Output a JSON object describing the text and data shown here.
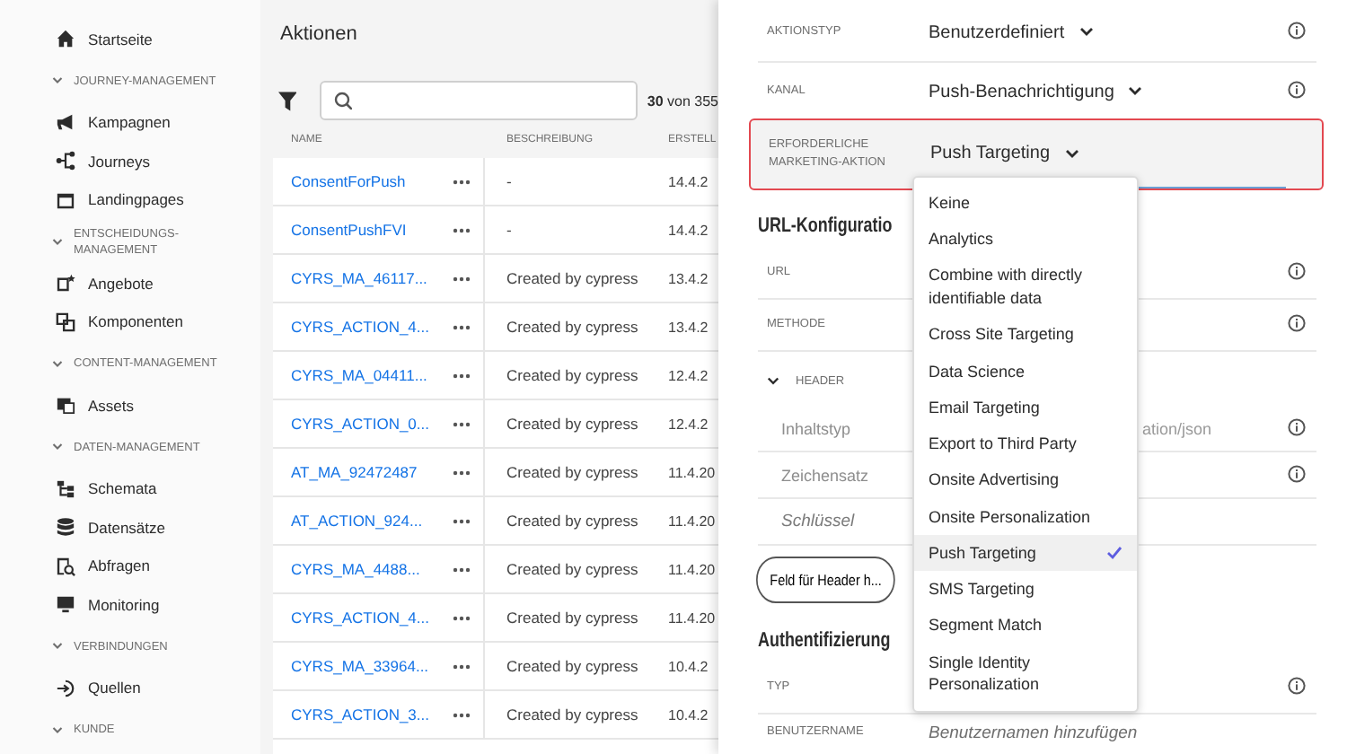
{
  "sidebar": {
    "home": {
      "label": "Startseite"
    },
    "sections": [
      {
        "title": "JOURNEY-MANAGEMENT",
        "expanded": true,
        "items": [
          {
            "label": "Kampagnen"
          },
          {
            "label": "Journeys"
          },
          {
            "label": "Landingpages"
          }
        ]
      },
      {
        "title": "ENTSCHEIDUNGS-MANAGEMENT",
        "expanded": true,
        "items": [
          {
            "label": "Angebote"
          },
          {
            "label": "Komponenten"
          }
        ]
      },
      {
        "title": "CONTENT-MANAGEMENT",
        "expanded": true,
        "items": [
          {
            "label": "Assets"
          }
        ]
      },
      {
        "title": "DATEN-MANAGEMENT",
        "expanded": true,
        "items": [
          {
            "label": "Schemata"
          },
          {
            "label": "Datensätze"
          },
          {
            "label": "Abfragen"
          },
          {
            "label": "Monitoring"
          }
        ]
      },
      {
        "title": "VERBINDUNGEN",
        "expanded": true,
        "items": [
          {
            "label": "Quellen"
          }
        ]
      },
      {
        "title": "KUNDE",
        "expanded": true
      }
    ]
  },
  "list": {
    "title": "Aktionen",
    "count": "**30** von 355",
    "columns": [
      "NAME",
      "BESCHREIBUNG",
      "ERSTELL"
    ],
    "rows": [
      {
        "name": "ConsentForPush",
        "description": "-",
        "created": "14.4.2"
      },
      {
        "name": "ConsentPushFVI",
        "description": "-",
        "created": "14.4.2"
      },
      {
        "name": "CYRS_MA_46117...",
        "description": "Created by cypress",
        "created": "13.4.2"
      },
      {
        "name": "CYRS_ACTION_4...",
        "description": "Created by cypress",
        "created": "13.4.2"
      },
      {
        "name": "CYRS_MA_04411...",
        "description": "Created by cypress",
        "created": "12.4.2"
      },
      {
        "name": "CYRS_ACTION_0...",
        "description": "Created by cypress",
        "created": "12.4.2"
      },
      {
        "name": "AT_MA_92472487",
        "description": "Created by cypress",
        "created": "11.4.20"
      },
      {
        "name": "AT_ACTION_924...",
        "description": "Created by cypress",
        "created": "11.4.20"
      },
      {
        "name": "CYRS_MA_4488...",
        "description": "Created by cypress",
        "created": "11.4.20"
      },
      {
        "name": "CYRS_ACTION_4...",
        "description": "Created by cypress",
        "created": "11.4.20"
      },
      {
        "name": "CYRS_MA_33964...",
        "description": "Created by cypress",
        "created": "10.4.2"
      },
      {
        "name": "CYRS_ACTION_3...",
        "description": "Created by cypress",
        "created": "10.4.2"
      }
    ]
  },
  "detail": {
    "fields": [
      {
        "label": "AKTIONSTYP",
        "value": "Benutzerdefiniert",
        "kind": "select",
        "info": true,
        "error": false
      },
      {
        "label": "KANAL",
        "value": "Push-Benachrichtigung",
        "kind": "select",
        "info": true,
        "error": false
      },
      {
        "label": "ERFORDERLICHE MARKETING-AKTION",
        "value": "Push Targeting",
        "kind": "select",
        "error": true
      }
    ],
    "dropdown": {
      "options": [
        {
          "label": "Keine",
          "selected": false
        },
        {
          "label": "Analytics",
          "selected": false
        },
        {
          "label": "Combine with directly identifiable data",
          "selected": false
        },
        {
          "label": "Cross Site Targeting",
          "selected": false
        },
        {
          "label": "Data Science",
          "selected": false
        },
        {
          "label": "Email Targeting",
          "selected": false
        },
        {
          "label": "Export to Third Party",
          "selected": false
        },
        {
          "label": "Onsite Advertising",
          "selected": false
        },
        {
          "label": "Onsite Personalization",
          "selected": false
        },
        {
          "label": "Push Targeting",
          "selected": true
        },
        {
          "label": "SMS Targeting",
          "selected": false
        },
        {
          "label": "Segment Match",
          "selected": false
        },
        {
          "label": "Single Identity Personalization",
          "selected": false
        }
      ]
    },
    "url_configuration": {
      "title": "URL-Konfiguratio",
      "fields": [
        {
          "label": "URL",
          "info": true
        },
        {
          "label": "METHODE",
          "info": true
        }
      ],
      "header": {
        "label": "HEADER",
        "expanded": true,
        "fields": [
          {
            "label": "Inhaltstyp",
            "value": "ation/json",
            "info": true
          },
          {
            "label": "Zeichensatz",
            "info": true
          },
          {
            "placeholder": "Schlüssel"
          }
        ],
        "add_button": "Feld für Header h..."
      }
    },
    "authentication": {
      "title": "Authentifizierung",
      "fields": [
        {
          "label": "TYP",
          "info": true
        },
        {
          "label": "BENUTZERNAME",
          "placeholder": "Benutzernamen hinzufügen"
        }
      ]
    }
  }
}
